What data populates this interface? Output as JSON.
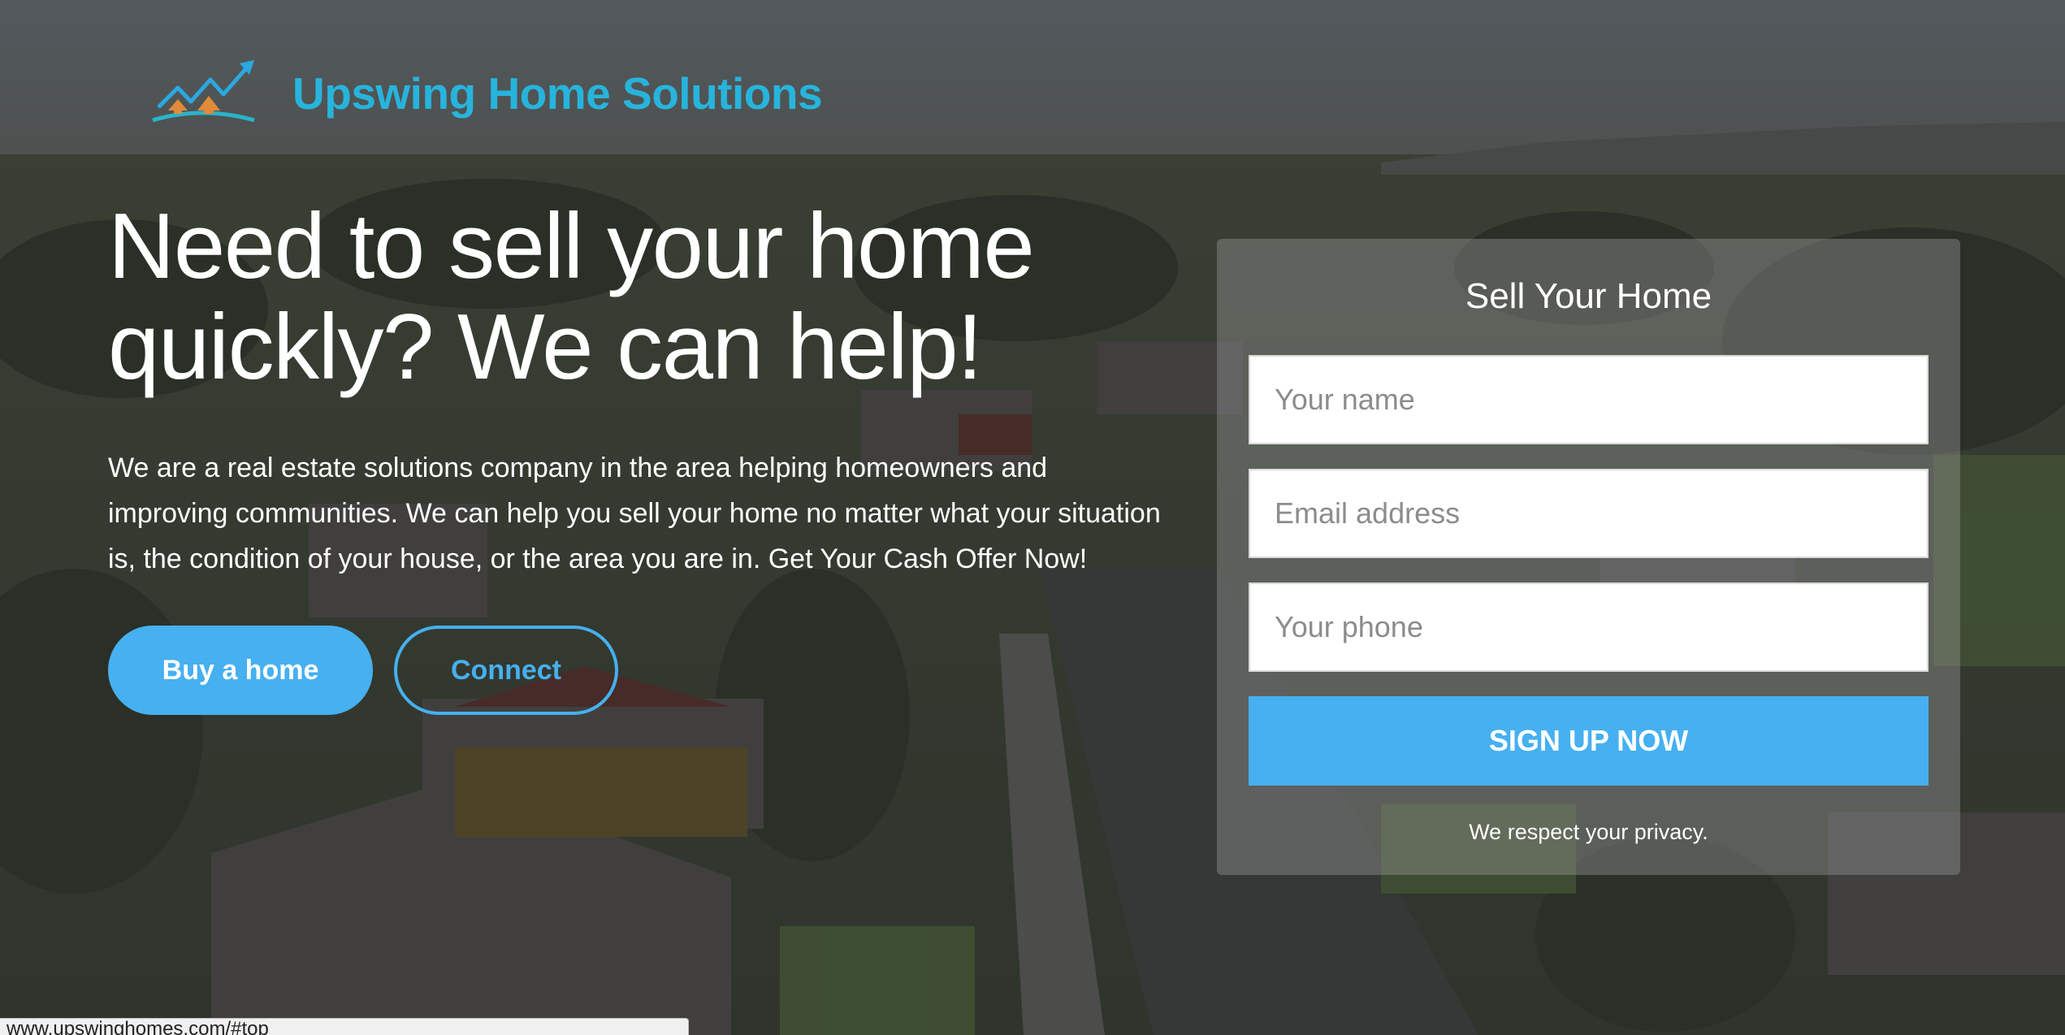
{
  "header": {
    "brand_name": "Upswing Home Solutions",
    "logo_icon": "house-chart-upswing-logo"
  },
  "hero": {
    "headline_line1": "Need to sell your home",
    "headline_line2": "quickly? We can help!",
    "lead": "We are a real estate solutions company in the area helping homeowners and improving communities. We can help you sell your home no matter what your situation is, the condition of your house, or the area you are in. Get Your Cash Offer Now!",
    "primary_button": "Buy a home",
    "secondary_button": "Connect"
  },
  "form": {
    "title": "Sell Your Home",
    "name_placeholder": "Your name",
    "email_placeholder": "Email address",
    "phone_placeholder": "Your phone",
    "submit_label": "SIGN UP NOW",
    "privacy_note": "We respect your privacy."
  },
  "status_bar": {
    "url": "www.upswinghomes.com/#top"
  },
  "colors": {
    "brand": "#27b4dc",
    "accent": "#46b0f0"
  }
}
